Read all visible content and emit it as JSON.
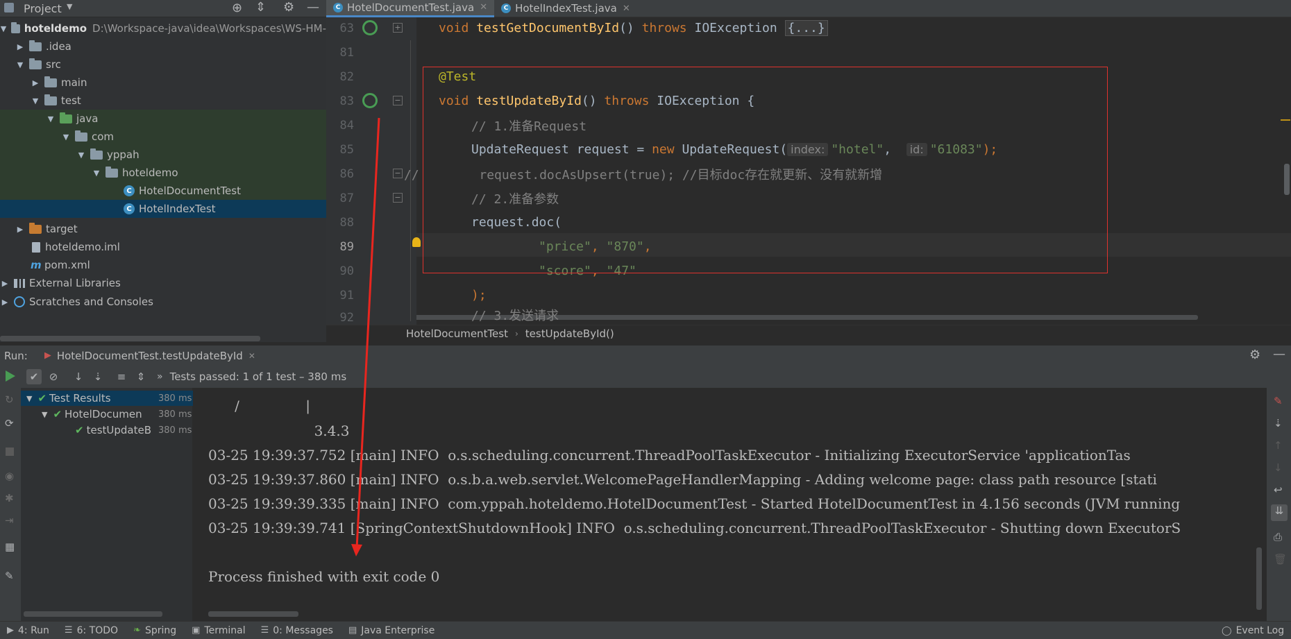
{
  "project": {
    "title": "Project",
    "tree": [
      {
        "label": "hoteldemo",
        "path": "D:\\Workspace-java\\idea\\Workspaces\\WS-HM-"
      },
      {
        "label": ".idea"
      },
      {
        "label": "src"
      },
      {
        "label": "main"
      },
      {
        "label": "test"
      },
      {
        "label": "java"
      },
      {
        "label": "com"
      },
      {
        "label": "yppah"
      },
      {
        "label": "hoteldemo"
      },
      {
        "label": "HotelDocumentTest"
      },
      {
        "label": "HotelIndexTest"
      },
      {
        "label": "target"
      },
      {
        "label": "hoteldemo.iml"
      },
      {
        "label": "pom.xml"
      },
      {
        "label": "External Libraries"
      },
      {
        "label": "Scratches and Consoles"
      }
    ]
  },
  "editor": {
    "tabs": [
      {
        "label": "HotelDocumentTest.java",
        "active": true
      },
      {
        "label": "HotelIndexTest.java",
        "active": false
      }
    ],
    "line_numbers": [
      "63",
      "81",
      "82",
      "83",
      "84",
      "85",
      "86",
      "87",
      "88",
      "89",
      "90",
      "91",
      "92"
    ],
    "code": {
      "l63_kw": "void ",
      "l63_fn": "testGetDocumentById",
      "l63_rest": "() ",
      "l63_throws": "throws",
      "l63_exc": " IOException ",
      "l63_fold": "{...}",
      "l82_ann": "@Test",
      "l83_kw": "void ",
      "l83_fn": "testUpdateById",
      "l83_rest": "() ",
      "l83_throws": "throws",
      "l83_exc": " IOException {",
      "l84_cm": "// 1.准备Request",
      "l85_a": "UpdateRequest request = ",
      "l85_new": "new",
      "l85_b": " UpdateRequest(",
      "l85_hint1": "index:",
      "l85_s1": "\"hotel\"",
      "l85_c": ",  ",
      "l85_hint2": "id:",
      "l85_s2": "\"61083\"",
      "l85_end": ");",
      "l86_cm": "//        request.docAsUpsert(true); //目标doc存在就更新、没有就新增",
      "l87_cm": "// 2.准备参数",
      "l88": "request.doc(",
      "l89_s1": "\"price\"",
      "l89_c": ", ",
      "l89_s2": "\"870\"",
      "l89_end": ",",
      "l90_s1": "\"score\"",
      "l90_c": ", ",
      "l90_s2": "\"47\"",
      "l91": ");",
      "l92_cm": "// 3.发送请求"
    },
    "breadcrumb": [
      "HotelDocumentTest",
      "testUpdateById()"
    ]
  },
  "run": {
    "label": "Run:",
    "config": "HotelDocumentTest.testUpdateById",
    "status": "Tests passed: 1 of 1 test – 380 ms",
    "tests": [
      {
        "label": "Test Results",
        "time": "380 ms"
      },
      {
        "label": "HotelDocument",
        "time": "380 ms"
      },
      {
        "label": "testUpdateB",
        "time": "380 ms"
      }
    ],
    "console": [
      "      /               |",
      "                        3.4.3",
      "03-25 19:39:37.752 [main] INFO  o.s.scheduling.concurrent.ThreadPoolTaskExecutor - Initializing ExecutorService 'applicationTas",
      "03-25 19:39:37.860 [main] INFO  o.s.b.a.web.servlet.WelcomePageHandlerMapping - Adding welcome page: class path resource [stati",
      "03-25 19:39:39.335 [main] INFO  com.yppah.hoteldemo.HotelDocumentTest - Started HotelDocumentTest in 4.156 seconds (JVM running",
      "03-25 19:39:39.741 [SpringContextShutdownHook] INFO  o.s.scheduling.concurrent.ThreadPoolTaskExecutor - Shutting down ExecutorS",
      "",
      "Process finished with exit code 0"
    ]
  },
  "statusbar": {
    "items": [
      "4: Run",
      "6: TODO",
      "Spring",
      "Terminal",
      "0: Messages",
      "Java Enterprise"
    ],
    "event_log": "Event Log"
  },
  "colors": {
    "highlight_box": "#e0332e",
    "arrow": "#e8261f",
    "passed": "#5fb85f"
  }
}
